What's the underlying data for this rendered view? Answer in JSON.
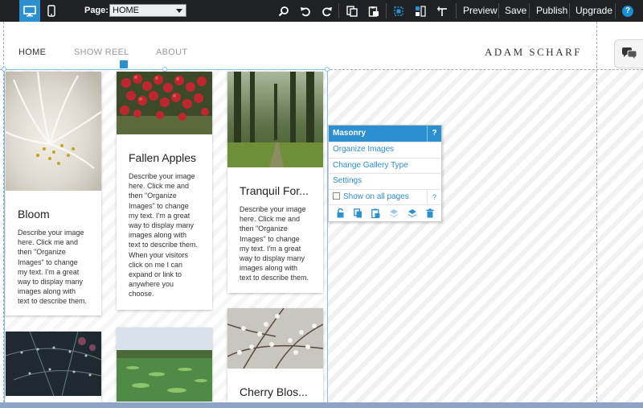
{
  "toolbar": {
    "page_label": "Page:",
    "page_value": "HOME",
    "preview_label": "Preview",
    "save_label": "Save",
    "publish_label": "Publish",
    "upgrade_label": "Upgrade",
    "help_label": "?",
    "icons": [
      "desktop-view-icon",
      "mobile-view-icon",
      "search-icon",
      "undo-icon",
      "redo-icon",
      "copy-page-icon",
      "paste-page-icon",
      "select-icon",
      "layout-icon",
      "ruler-icon",
      "help-icon"
    ]
  },
  "site": {
    "nav": [
      "HOME",
      "SHOW REEL",
      "ABOUT"
    ],
    "logo": "ADAM SCHARF"
  },
  "gallery": {
    "items": [
      {
        "title": "Bloom",
        "text": "Describe your image here.  Click me and then \"Organize Images\" to change my text.  I'm a great way to display many images along with text to describe them."
      },
      {
        "title": "Fallen Apples",
        "text": "Describe your image here.  Click me and then \"Organize Images\" to change my text.  I'm a great way to display many images along with text to describe them. When your visitors click on me I can expand or link to anywhere you choose."
      },
      {
        "title": "Tranquil For...",
        "text": "Describe your image here.  Click me and then \"Organize Images\" to change my text.  I'm a great way to display many images along with text to describe them."
      },
      {
        "title": "Cherry Blos...",
        "text": ""
      }
    ]
  },
  "menu": {
    "title": "Masonry",
    "help": "?",
    "items": [
      "Organize Images",
      "Change Gallery Type",
      "Settings"
    ],
    "checkbox_label": "Show on all pages",
    "checkbox_checked": false,
    "icons": [
      "unlock-icon",
      "duplicate-icon",
      "paste-icon",
      "layer-back-icon",
      "layer-front-icon",
      "trash-icon"
    ]
  },
  "colors": {
    "toolbar_bg": "#1f2124",
    "accent": "#2b8fd0"
  }
}
